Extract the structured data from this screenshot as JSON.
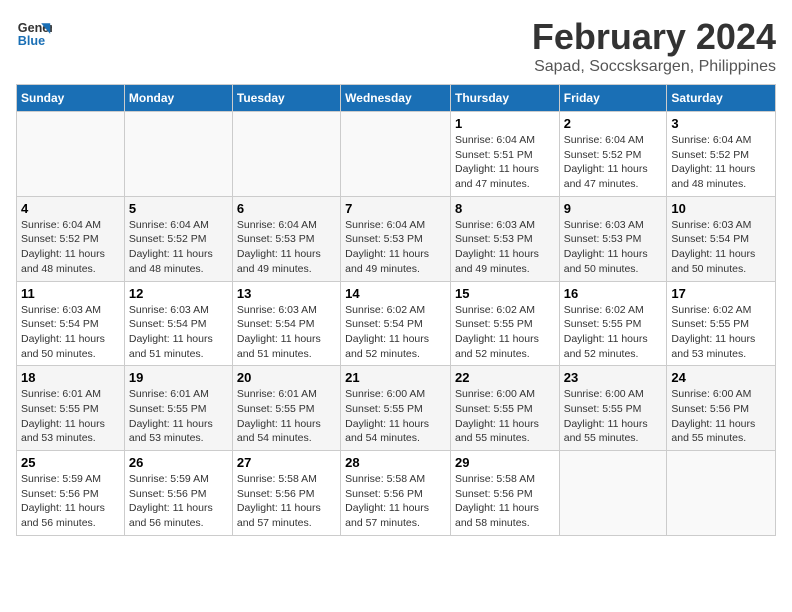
{
  "header": {
    "logo_line1": "General",
    "logo_line2": "Blue",
    "month": "February 2024",
    "location": "Sapad, Soccsksargen, Philippines"
  },
  "weekdays": [
    "Sunday",
    "Monday",
    "Tuesday",
    "Wednesday",
    "Thursday",
    "Friday",
    "Saturday"
  ],
  "weeks": [
    [
      {
        "day": "",
        "info": ""
      },
      {
        "day": "",
        "info": ""
      },
      {
        "day": "",
        "info": ""
      },
      {
        "day": "",
        "info": ""
      },
      {
        "day": "1",
        "info": "Sunrise: 6:04 AM\nSunset: 5:51 PM\nDaylight: 11 hours and 47 minutes."
      },
      {
        "day": "2",
        "info": "Sunrise: 6:04 AM\nSunset: 5:52 PM\nDaylight: 11 hours and 47 minutes."
      },
      {
        "day": "3",
        "info": "Sunrise: 6:04 AM\nSunset: 5:52 PM\nDaylight: 11 hours and 48 minutes."
      }
    ],
    [
      {
        "day": "4",
        "info": "Sunrise: 6:04 AM\nSunset: 5:52 PM\nDaylight: 11 hours and 48 minutes."
      },
      {
        "day": "5",
        "info": "Sunrise: 6:04 AM\nSunset: 5:52 PM\nDaylight: 11 hours and 48 minutes."
      },
      {
        "day": "6",
        "info": "Sunrise: 6:04 AM\nSunset: 5:53 PM\nDaylight: 11 hours and 49 minutes."
      },
      {
        "day": "7",
        "info": "Sunrise: 6:04 AM\nSunset: 5:53 PM\nDaylight: 11 hours and 49 minutes."
      },
      {
        "day": "8",
        "info": "Sunrise: 6:03 AM\nSunset: 5:53 PM\nDaylight: 11 hours and 49 minutes."
      },
      {
        "day": "9",
        "info": "Sunrise: 6:03 AM\nSunset: 5:53 PM\nDaylight: 11 hours and 50 minutes."
      },
      {
        "day": "10",
        "info": "Sunrise: 6:03 AM\nSunset: 5:54 PM\nDaylight: 11 hours and 50 minutes."
      }
    ],
    [
      {
        "day": "11",
        "info": "Sunrise: 6:03 AM\nSunset: 5:54 PM\nDaylight: 11 hours and 50 minutes."
      },
      {
        "day": "12",
        "info": "Sunrise: 6:03 AM\nSunset: 5:54 PM\nDaylight: 11 hours and 51 minutes."
      },
      {
        "day": "13",
        "info": "Sunrise: 6:03 AM\nSunset: 5:54 PM\nDaylight: 11 hours and 51 minutes."
      },
      {
        "day": "14",
        "info": "Sunrise: 6:02 AM\nSunset: 5:54 PM\nDaylight: 11 hours and 52 minutes."
      },
      {
        "day": "15",
        "info": "Sunrise: 6:02 AM\nSunset: 5:55 PM\nDaylight: 11 hours and 52 minutes."
      },
      {
        "day": "16",
        "info": "Sunrise: 6:02 AM\nSunset: 5:55 PM\nDaylight: 11 hours and 52 minutes."
      },
      {
        "day": "17",
        "info": "Sunrise: 6:02 AM\nSunset: 5:55 PM\nDaylight: 11 hours and 53 minutes."
      }
    ],
    [
      {
        "day": "18",
        "info": "Sunrise: 6:01 AM\nSunset: 5:55 PM\nDaylight: 11 hours and 53 minutes."
      },
      {
        "day": "19",
        "info": "Sunrise: 6:01 AM\nSunset: 5:55 PM\nDaylight: 11 hours and 53 minutes."
      },
      {
        "day": "20",
        "info": "Sunrise: 6:01 AM\nSunset: 5:55 PM\nDaylight: 11 hours and 54 minutes."
      },
      {
        "day": "21",
        "info": "Sunrise: 6:00 AM\nSunset: 5:55 PM\nDaylight: 11 hours and 54 minutes."
      },
      {
        "day": "22",
        "info": "Sunrise: 6:00 AM\nSunset: 5:55 PM\nDaylight: 11 hours and 55 minutes."
      },
      {
        "day": "23",
        "info": "Sunrise: 6:00 AM\nSunset: 5:55 PM\nDaylight: 11 hours and 55 minutes."
      },
      {
        "day": "24",
        "info": "Sunrise: 6:00 AM\nSunset: 5:56 PM\nDaylight: 11 hours and 55 minutes."
      }
    ],
    [
      {
        "day": "25",
        "info": "Sunrise: 5:59 AM\nSunset: 5:56 PM\nDaylight: 11 hours and 56 minutes."
      },
      {
        "day": "26",
        "info": "Sunrise: 5:59 AM\nSunset: 5:56 PM\nDaylight: 11 hours and 56 minutes."
      },
      {
        "day": "27",
        "info": "Sunrise: 5:58 AM\nSunset: 5:56 PM\nDaylight: 11 hours and 57 minutes."
      },
      {
        "day": "28",
        "info": "Sunrise: 5:58 AM\nSunset: 5:56 PM\nDaylight: 11 hours and 57 minutes."
      },
      {
        "day": "29",
        "info": "Sunrise: 5:58 AM\nSunset: 5:56 PM\nDaylight: 11 hours and 58 minutes."
      },
      {
        "day": "",
        "info": ""
      },
      {
        "day": "",
        "info": ""
      }
    ]
  ]
}
